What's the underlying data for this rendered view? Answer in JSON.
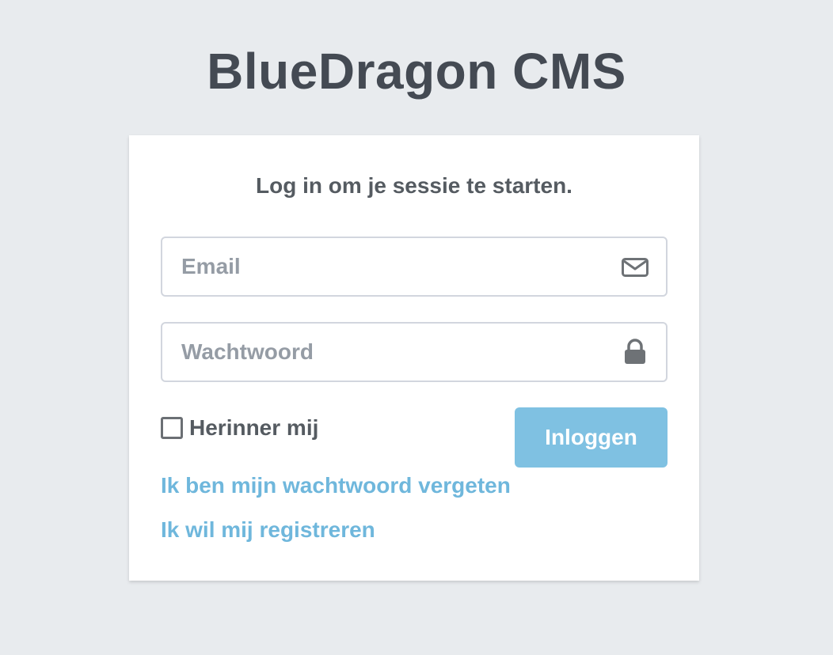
{
  "brand": {
    "title": "BlueDragon CMS"
  },
  "login": {
    "message": "Log in om je sessie te starten.",
    "email": {
      "placeholder": "Email",
      "value": "",
      "icon": "envelope-icon"
    },
    "password": {
      "placeholder": "Wachtwoord",
      "value": "",
      "icon": "lock-icon"
    },
    "remember": {
      "label": "Herinner mij",
      "checked": false
    },
    "submit_label": "Inloggen",
    "forgot_link": "Ik ben mijn wachtwoord vergeten",
    "register_link": "Ik wil mij registreren"
  },
  "colors": {
    "background": "#e8ebee",
    "accent": "#7fc1e2",
    "link": "#6fb7dc",
    "heading": "#444a53"
  }
}
